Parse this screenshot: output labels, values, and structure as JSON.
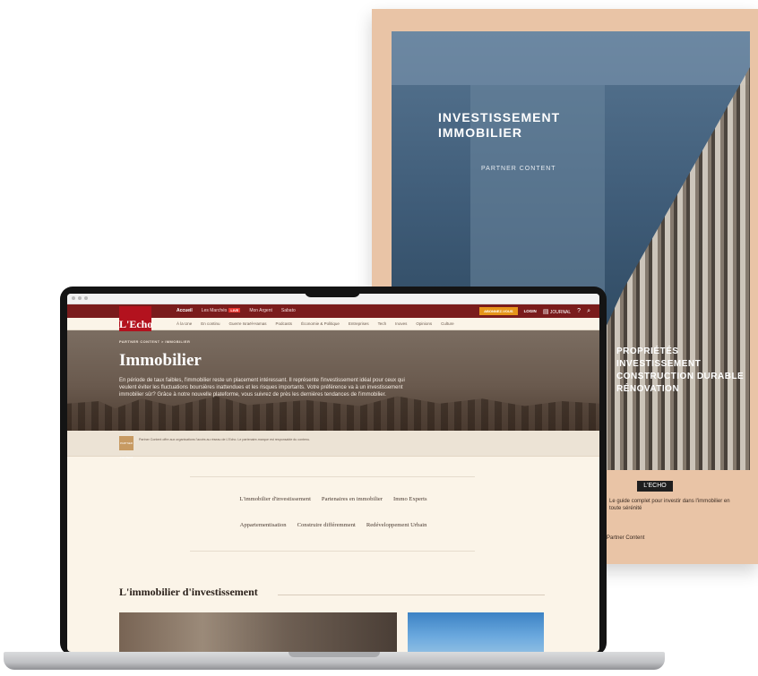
{
  "magazine": {
    "title_line1": "INVESTISSEMENT",
    "title_line2": "IMMOBILIER",
    "subtitle": "PARTNER CONTENT",
    "side_lines": [
      "PROPRIÉTÉS",
      "INVESTISSEMENT",
      "CONSTRUCTION DURABLE",
      "RÉNOVATION"
    ],
    "badge": "L'ECHO",
    "caption": "Le guide complet pour investir dans l'immobilier en toute sérénité",
    "footer": "Partner Content"
  },
  "site": {
    "logo": "L'Echo",
    "nav_main": [
      {
        "label": "Accueil",
        "active": true
      },
      {
        "label": "Les Marchés",
        "badge": "LIVE"
      },
      {
        "label": "Mon Argent"
      },
      {
        "label": "Sabato"
      }
    ],
    "nav_right": {
      "subscribe": "ABONNEZ-VOUS",
      "login": "LOGIN",
      "journal": "JOURNAL"
    },
    "nav_sub": [
      "À la Une",
      "En continu",
      "Guerre Israël-Hamas",
      "Podcasts",
      "Économie & Politique",
      "Entreprises",
      "Tech",
      "Inoves",
      "Opinions",
      "Culture"
    ],
    "breadcrumb": "PARTNER CONTENT  >  IMMOBILIER",
    "hero_title": "Immobilier",
    "hero_text": "En période de taux faibles, l'immobilier reste un placement intéressant. Il représente l'investissement idéal pour ceux qui veulent éviter les fluctuations boursières inattendues et les risques importants. Votre préférence va à un investissement immobilier sûr? Grâce à notre nouvelle plateforme, vous suivrez de près les dernières tendances de l'immobilier.",
    "partner_logo": "PARTNER CONTENT",
    "partner_text": "Partner Content offre aux organisations l'accès au réseau de L'Echo. Le partenaire-marque est responsable du contenu.",
    "links_row1": [
      "L'immobilier d'investissement",
      "Partenaires en immobilier",
      "Immo Experts"
    ],
    "links_row2": [
      "Appartementisation",
      "Construire différemment",
      "Redéveloppement Urbain"
    ],
    "section_title": "L'immobilier d'investissement"
  }
}
